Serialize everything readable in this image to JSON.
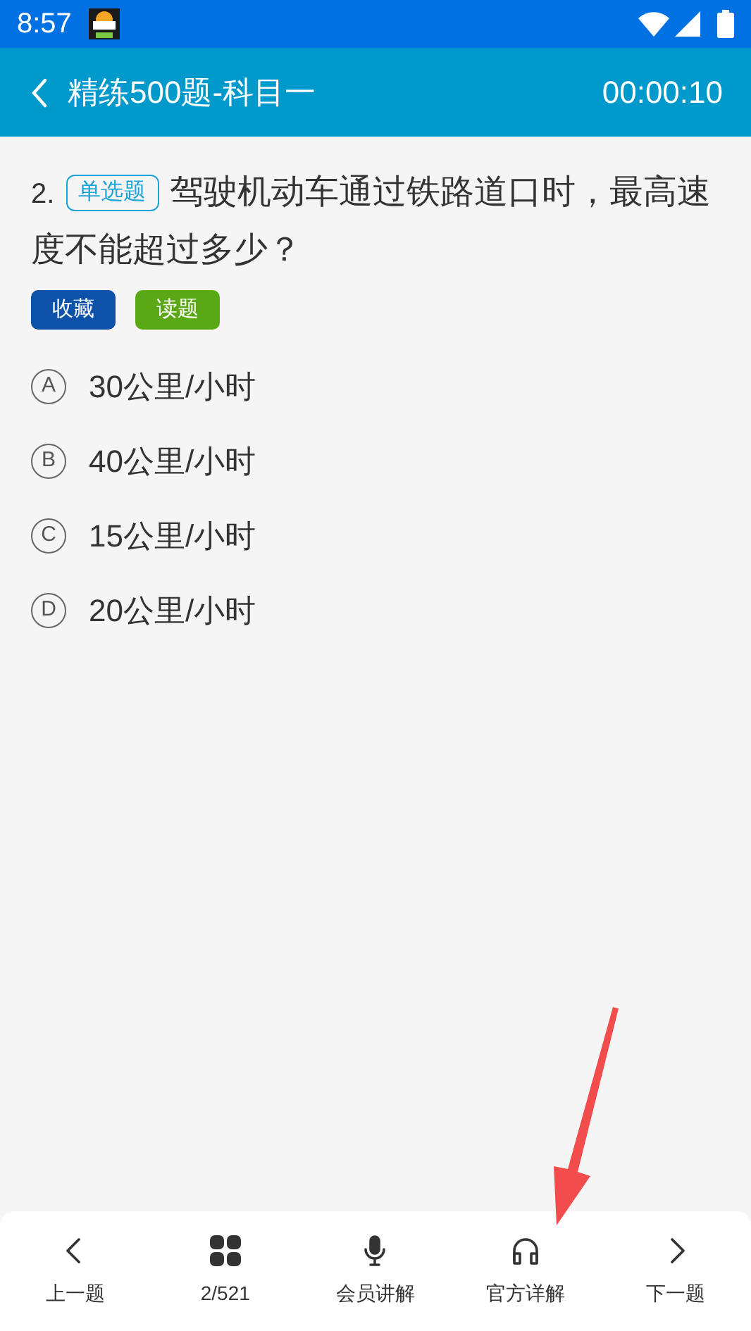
{
  "status_bar": {
    "time": "8:57"
  },
  "header": {
    "title": "精练500题-科目一",
    "timer": "00:00:10"
  },
  "question": {
    "number": "2.",
    "type": "单选题",
    "text": "驾驶机动车通过铁路道口时，最高速度不能超过多少？"
  },
  "actions": [
    {
      "label": "收藏",
      "color": "#0d52a8"
    },
    {
      "label": "读题",
      "color": "#5aa815"
    }
  ],
  "options": [
    {
      "letter": "A",
      "text": "30公里/小时",
      "selected": false
    },
    {
      "letter": "B",
      "text": "40公里/小时",
      "selected": false
    },
    {
      "letter": "C",
      "text": "15公里/小时",
      "selected": false
    },
    {
      "letter": "D",
      "text": "20公里/小时",
      "selected": false
    }
  ],
  "bottom_nav": [
    {
      "kind": "prev",
      "label": "上一题"
    },
    {
      "kind": "grid",
      "label": "2/521"
    },
    {
      "kind": "mic",
      "label": "会员讲解"
    },
    {
      "kind": "headphones",
      "label": "官方详解"
    },
    {
      "kind": "next",
      "label": "下一题"
    }
  ]
}
